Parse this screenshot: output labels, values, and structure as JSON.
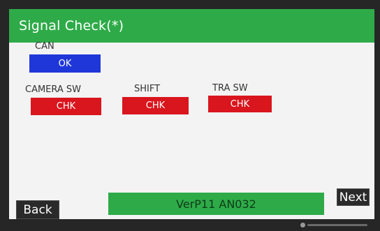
{
  "screen": {
    "title": "Signal Check(*)"
  },
  "signals": {
    "can": {
      "label": "CAN",
      "status": "OK"
    },
    "camera_sw": {
      "label": "CAMERA SW",
      "status": "CHK"
    },
    "shift": {
      "label": "SHIFT",
      "status": "CHK"
    },
    "tra_sw": {
      "label": "TRA SW",
      "status": "CHK"
    }
  },
  "footer": {
    "back_label": "Back",
    "version": "VerP11 AN032",
    "next_label": "Next"
  },
  "colors": {
    "title_bar": "#2eab48",
    "ok": "#1f37d8",
    "chk": "#d9151d"
  }
}
